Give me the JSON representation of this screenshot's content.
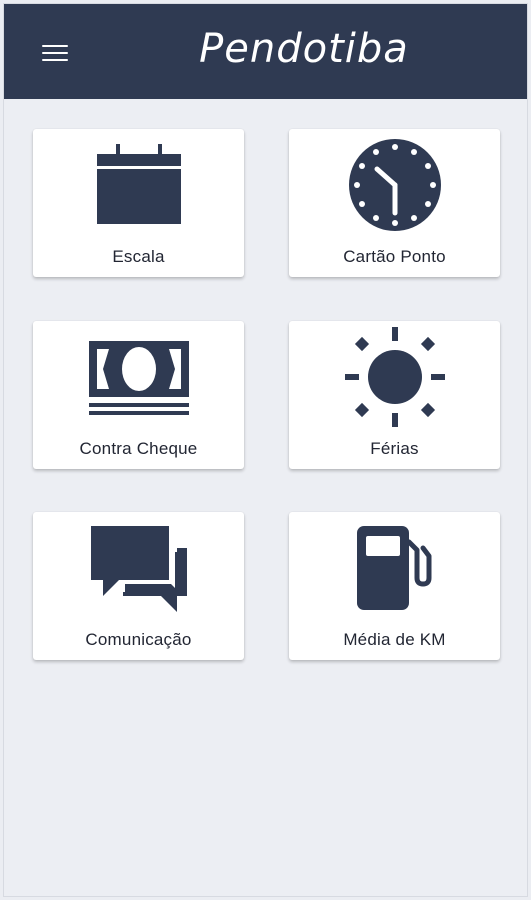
{
  "app": {
    "title": "Pendotiba"
  },
  "colors": {
    "header": "#2f3a52",
    "icon": "#2f3a52",
    "background": "#eceef3",
    "card": "#ffffff"
  },
  "tiles": [
    {
      "label": "Escala",
      "icon": "calendar-icon"
    },
    {
      "label": "Cartão Ponto",
      "icon": "clock-icon"
    },
    {
      "label": "Contra Cheque",
      "icon": "banknote-icon"
    },
    {
      "label": "Férias",
      "icon": "sun-icon"
    },
    {
      "label": "Comunicação",
      "icon": "chat-bubbles-icon"
    },
    {
      "label": "Média de KM",
      "icon": "fuel-pump-icon"
    }
  ]
}
